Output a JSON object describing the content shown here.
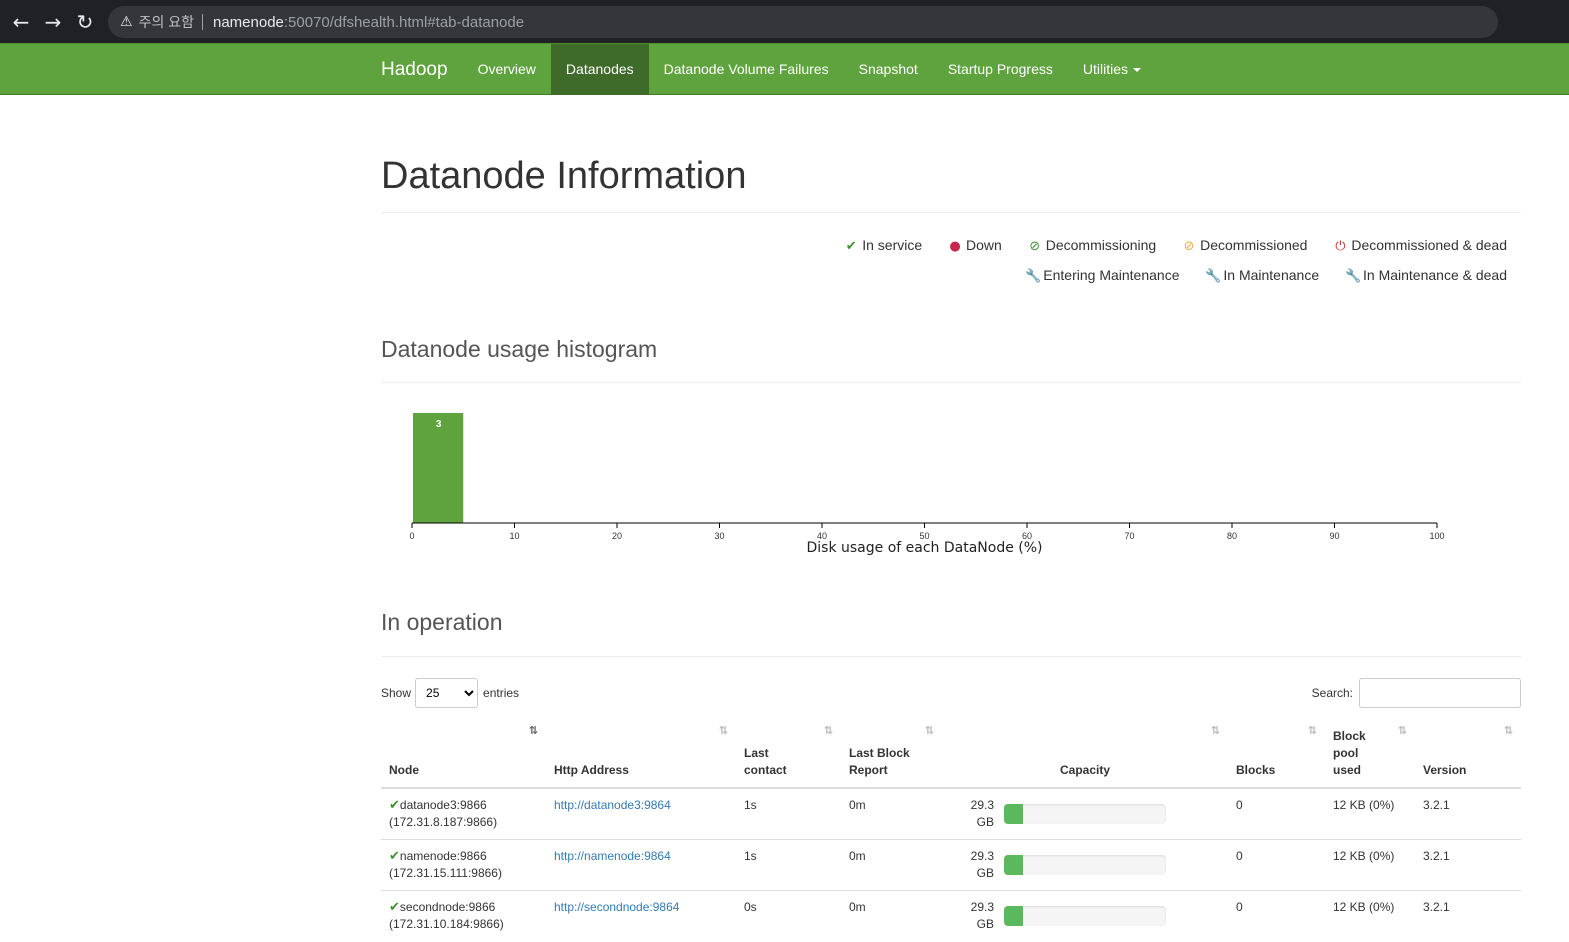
{
  "browser": {
    "warning": "주의 요함",
    "url_host": "namenode",
    "url_path": ":50070/dfshealth.html#tab-datanode"
  },
  "navbar": {
    "brand": "Hadoop",
    "links": [
      "Overview",
      "Datanodes",
      "Datanode Volume Failures",
      "Snapshot",
      "Startup Progress",
      "Utilities"
    ],
    "active": "Datanodes"
  },
  "page": {
    "title": "Datanode Information",
    "legend": [
      {
        "label": "In service",
        "icon": "check-icon",
        "color": "#3f8f2f"
      },
      {
        "label": "Down",
        "icon": "exclamation-circle-icon",
        "color": "#c7254e"
      },
      {
        "label": "Decommissioning",
        "icon": "ban-icon",
        "color": "#3f8f2f"
      },
      {
        "label": "Decommissioned",
        "icon": "ban-icon",
        "color": "#f0ad4e"
      },
      {
        "label": "Decommissioned & dead",
        "icon": "power-icon",
        "color": "#c9302c"
      },
      {
        "label": "Entering Maintenance",
        "icon": "wrench-icon",
        "color": "#3f8f2f"
      },
      {
        "label": "In Maintenance",
        "icon": "wrench-icon",
        "color": "#f0ad4e"
      },
      {
        "label": "In Maintenance & dead",
        "icon": "wrench-icon",
        "color": "#c9302c"
      }
    ],
    "histogram_title": "Datanode usage histogram",
    "operation_title": "In operation"
  },
  "chart_data": {
    "type": "bar",
    "title": "",
    "xlabel": "Disk usage of each DataNode (%)",
    "ylabel": "",
    "xlim": [
      0,
      100
    ],
    "xticks": [
      0,
      10,
      20,
      30,
      40,
      50,
      60,
      70,
      80,
      90,
      100
    ],
    "bins": [
      {
        "x0": 0,
        "x1": 5,
        "count": 3
      }
    ],
    "grid": false,
    "bar_color": "#5fa33e"
  },
  "table": {
    "show_label": "Show",
    "entries_label": "entries",
    "page_length": "25",
    "search_label": "Search:",
    "search_value": "",
    "columns": [
      "Node",
      "Http Address",
      "Last contact",
      "Last Block Report",
      "Capacity",
      "Blocks",
      "Block pool used",
      "Version"
    ],
    "rows": [
      {
        "node": "datanode3:9866",
        "ip": "(172.31.8.187:9866)",
        "http": "http://datanode3:9864",
        "contact": "1s",
        "report": "0m",
        "capacity": "29.3 GB",
        "used_fraction": 0.12,
        "blocks": "0",
        "pool": "12 KB (0%)",
        "version": "3.2.1"
      },
      {
        "node": "namenode:9866",
        "ip": "(172.31.15.111:9866)",
        "http": "http://namenode:9864",
        "contact": "1s",
        "report": "0m",
        "capacity": "29.3 GB",
        "used_fraction": 0.12,
        "blocks": "0",
        "pool": "12 KB (0%)",
        "version": "3.2.1"
      },
      {
        "node": "secondnode:9866",
        "ip": "(172.31.10.184:9866)",
        "http": "http://secondnode:9864",
        "contact": "0s",
        "report": "0m",
        "capacity": "29.3 GB",
        "used_fraction": 0.12,
        "blocks": "0",
        "pool": "12 KB (0%)",
        "version": "3.2.1"
      }
    ]
  }
}
